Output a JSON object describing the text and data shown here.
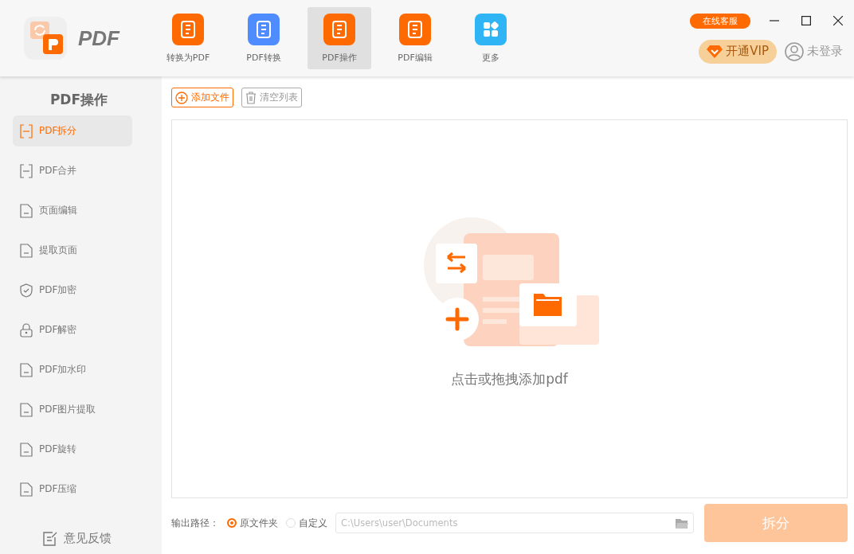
{
  "app": {
    "logo_text": "PDF"
  },
  "nav_tabs": [
    {
      "label": "转换为PDF",
      "color": "#ff6a00",
      "selected": false
    },
    {
      "label": "PDF转换",
      "color": "#4f8cff",
      "selected": false
    },
    {
      "label": "PDF操作",
      "color": "#ff6a00",
      "selected": true
    },
    {
      "label": "PDF编辑",
      "color": "#ff6a00",
      "selected": false
    },
    {
      "label": "更多",
      "color": "#2fb5f5",
      "selected": false
    }
  ],
  "support_badge": "在线客服",
  "vip_button": "开通VIP",
  "login": "未登录",
  "sidebar": {
    "title": "PDF操作",
    "items": [
      {
        "label": "PDF拆分",
        "selected": true
      },
      {
        "label": "PDF合并",
        "selected": false
      },
      {
        "label": "页面编辑",
        "selected": false
      },
      {
        "label": "提取页面",
        "selected": false
      },
      {
        "label": "PDF加密",
        "selected": false
      },
      {
        "label": "PDF解密",
        "selected": false
      },
      {
        "label": "PDF加水印",
        "selected": false
      },
      {
        "label": "PDF图片提取",
        "selected": false
      },
      {
        "label": "PDF旋转",
        "selected": false
      },
      {
        "label": "PDF压缩",
        "selected": false
      }
    ],
    "feedback": "意见反馈"
  },
  "toolbar": {
    "add_file": "添加文件",
    "clear_list": "清空列表"
  },
  "drop_zone": {
    "hint": "点击或拖拽添加pdf"
  },
  "output": {
    "label": "输出路径：",
    "options": [
      {
        "label": "原文件夹",
        "selected": true
      },
      {
        "label": "自定义",
        "selected": false
      }
    ],
    "path": "C:\\Users\\user\\Documents",
    "path_disabled": true
  },
  "action_button": {
    "label": "拆分",
    "disabled": true
  }
}
